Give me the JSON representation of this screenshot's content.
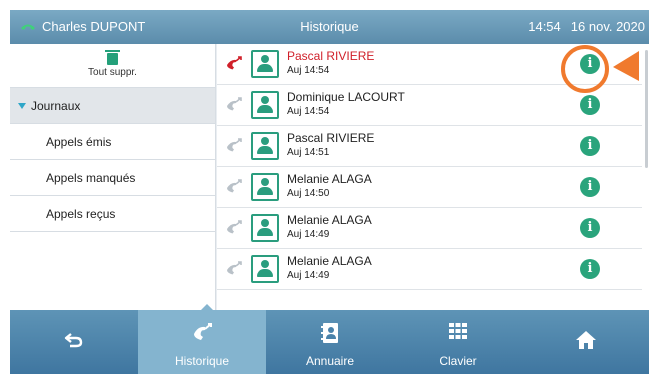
{
  "header": {
    "user_name": "Charles DUPONT",
    "title": "Historique",
    "time": "14:54",
    "date": "16 nov. 2020"
  },
  "sidebar": {
    "delete_all_label": "Tout suppr.",
    "section_label": "Journaux",
    "items": [
      {
        "label": "Appels émis"
      },
      {
        "label": "Appels manqués"
      },
      {
        "label": "Appels reçus"
      }
    ]
  },
  "calls": [
    {
      "name": "Pascal RIVIERE",
      "time": "Auj 14:54",
      "status": "missed"
    },
    {
      "name": "Dominique LACOURT",
      "time": "Auj 14:54",
      "status": "normal"
    },
    {
      "name": "Pascal RIVIERE",
      "time": "Auj 14:51",
      "status": "normal"
    },
    {
      "name": "Melanie ALAGA",
      "time": "Auj 14:50",
      "status": "normal"
    },
    {
      "name": "Melanie ALAGA",
      "time": "Auj 14:49",
      "status": "normal"
    },
    {
      "name": "Melanie ALAGA",
      "time": "Auj 14:49",
      "status": "normal"
    }
  ],
  "info_glyph": "i",
  "nav": {
    "back_icon": "back-arrow-icon",
    "tabs": [
      {
        "label": "Historique",
        "icon": "call-history-icon",
        "active": true
      },
      {
        "label": "Annuaire",
        "icon": "contacts-book-icon",
        "active": false
      },
      {
        "label": "Clavier",
        "icon": "keypad-icon",
        "active": false
      }
    ],
    "home_icon": "home-icon"
  },
  "colors": {
    "accent_green": "#2aa47c",
    "missed_red": "#d0202a",
    "highlight_orange": "#f07a2e",
    "bar_blue": "#5b8cab"
  }
}
